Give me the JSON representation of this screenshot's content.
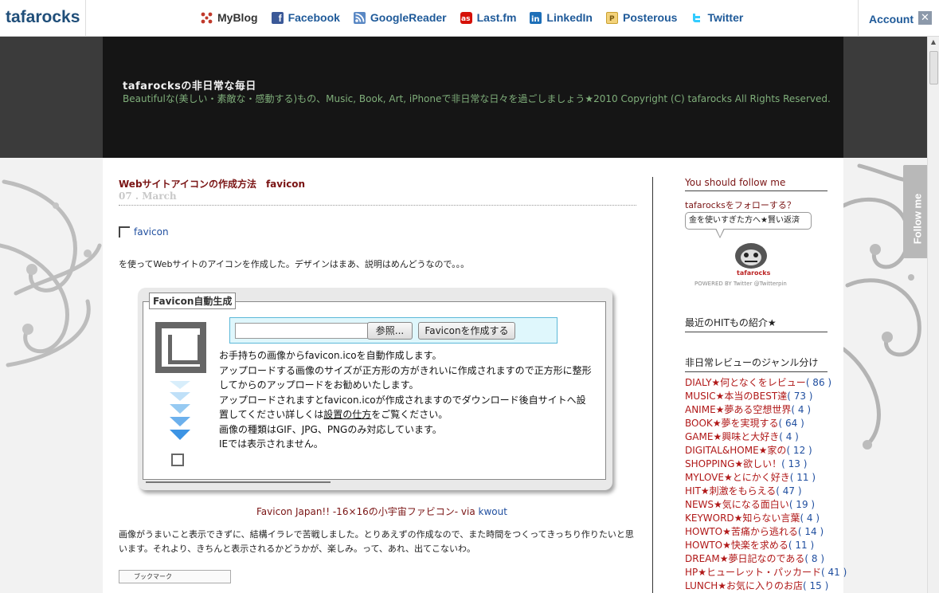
{
  "topbar": {
    "brand": "tafarocks",
    "links": [
      {
        "label": "MyBlog",
        "icon": "myblog-icon",
        "color": "#c0392b"
      },
      {
        "label": "Facebook",
        "icon": "facebook-icon",
        "color": "#3b5998"
      },
      {
        "label": "GoogleReader",
        "icon": "rss-icon",
        "color": "#3a6fb0"
      },
      {
        "label": "Last.fm",
        "icon": "lastfm-icon",
        "color": "#d51007"
      },
      {
        "label": "LinkedIn",
        "icon": "linkedin-icon",
        "color": "#1d6fb8"
      },
      {
        "label": "Posterous",
        "icon": "posterous-icon",
        "color": "#e8b02a"
      },
      {
        "label": "Twitter",
        "icon": "twitter-icon",
        "color": "#33ccff"
      }
    ],
    "account": "Account",
    "close": "✕"
  },
  "header": {
    "title": "tafarocksの非日常な毎日",
    "description": "Beautifulな(美しい・素敵な・感動する)もの、Music, Book, Art, iPhoneで非日常な日々を過ごしましょう★2010 Copyright (C) tafarocks All Rights Reserved."
  },
  "post": {
    "title": "Webサイトアイコンの作成方法　favicon",
    "date": "07 . March",
    "favicon_link": "favicon",
    "intro": "を使ってWebサイトのアイコンを作成した。デザインはまあ、説明はめんどうなので。。。",
    "widget": {
      "legend": "Favicon自動生成",
      "file_placeholder": "",
      "browse_label": "参照...",
      "create_label": "Faviconを作成する",
      "lines": [
        "お手持ちの画像からfavicon.icoを自動作成します。",
        "アップロードする画像のサイズが正方形の方がきれいに作成されますので正方形に整形してからのアップロードをお勧めいたします。",
        "アップロードされますとfavicon.icoが作成されますのでダウンロード後自サイトへ設置してください詳しくは",
        "設置の仕方",
        "をご覧ください。",
        "画像の種類はGIF、JPG、PNGのみ対応しています。",
        "IEでは表示されません。"
      ]
    },
    "via_text": "Favicon Japan!! -16×16の小宇宙ファビコン- via ",
    "via_link": "kwout",
    "body": "画像がうまいこと表示できずに、結構イラレで苦戦しました。とりあえずの作成なので、また時間をつくってきっちり作りたいと思います。それより、きちんと表示されるかどうかが、楽しみ。って、あれ、出てこないわ。",
    "bookmark": "ブックマーク"
  },
  "sidebar": {
    "follow_head": "You should follow me",
    "follow_sub": "tafarocksをフォローする？",
    "bubble": "金を使いすぎた方へ★賢い返済",
    "avatar_label": "tafarocks",
    "powered": "POWERED BY Twitter @Twitterpin",
    "hit_head": "最近のHITもの紹介★",
    "genre_head": "非日常レビューのジャンル分け",
    "genres": [
      {
        "name": "DIALY★何となくをレビュー",
        "count": "( 86 )"
      },
      {
        "name": "MUSIC★本当のBEST達",
        "count": "( 73 )"
      },
      {
        "name": "ANIME★夢ある空想世界",
        "count": "( 4 )"
      },
      {
        "name": "BOOK★夢を実現する",
        "count": "( 64 )"
      },
      {
        "name": "GAME★興味と大好き",
        "count": "( 4 )"
      },
      {
        "name": "DIGITAL&HOME★家の",
        "count": "( 12 )"
      },
      {
        "name": "SHOPPING★欲しい！",
        "count": "( 13 )"
      },
      {
        "name": "MYLOVE★とにかく好き",
        "count": "( 11 )"
      },
      {
        "name": "HIT★刺激をもらえる",
        "count": "( 47 )"
      },
      {
        "name": "NEWS★気になる面白い",
        "count": "( 19 )"
      },
      {
        "name": "KEYWORD★知らない言葉",
        "count": "( 4 )"
      },
      {
        "name": "HOWTO★苦痛から逃れる",
        "count": "( 14 )"
      },
      {
        "name": "HOWTO★快楽を求める",
        "count": "( 11 )"
      },
      {
        "name": "DREAM★夢日記なのである",
        "count": "( 8 )"
      },
      {
        "name": "HP★ヒューレット・パッカード",
        "count": "( 41 )"
      },
      {
        "name": "LUNCH★お気に入りのお店",
        "count": "( 15 )"
      }
    ]
  },
  "follow_tab": "Follow me"
}
